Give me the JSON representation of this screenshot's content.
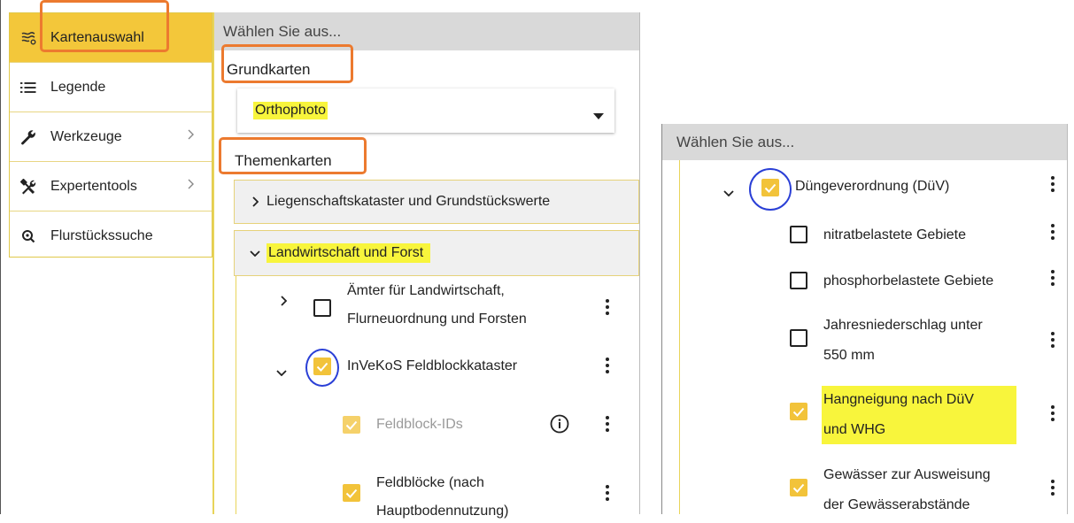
{
  "sidebar": {
    "items": [
      {
        "label": "Kartenauswahl",
        "icon": "layers-icon",
        "active": true
      },
      {
        "label": "Legende",
        "icon": "list-icon",
        "active": false
      },
      {
        "label": "Werkzeuge",
        "icon": "wrench-icon",
        "active": false,
        "has_submenu": true
      },
      {
        "label": "Expertentools",
        "icon": "tools-icon",
        "active": false,
        "has_submenu": true
      },
      {
        "label": "Flurstückssuche",
        "icon": "search-icon",
        "active": false
      }
    ]
  },
  "panel": {
    "header": "Wählen Sie aus...",
    "grundkarten_label": "Grundkarten",
    "basemap_select": {
      "value": "Orthophoto"
    },
    "themenkarten_label": "Themenkarten",
    "groups": [
      {
        "label": "Liegenschaftskataster und Grundstückswerte",
        "expanded": false
      },
      {
        "label": "Landwirtschaft und Forst",
        "expanded": true
      }
    ],
    "layers": [
      {
        "line1": "Ämter für Landwirtschaft,",
        "line2": "Flurneuordnung und Forsten",
        "checked": false,
        "expandable": true,
        "expanded": false
      },
      {
        "line1": "InVeKoS Feldblockkataster",
        "checked": true,
        "expandable": true,
        "expanded": true
      },
      {
        "line1": "Feldblock-IDs",
        "checked": true,
        "disabled": true,
        "info": true
      },
      {
        "line1": "Feldblöcke (nach",
        "line2": "Hauptbodennutzung)",
        "checked": true
      }
    ]
  },
  "right_panel": {
    "header": "Wählen Sie aus...",
    "layers": [
      {
        "line1": "Düngeverordnung (DüV)",
        "checked": true,
        "expandable": true,
        "expanded": true
      },
      {
        "line1": "nitratbelastete Gebiete",
        "checked": false
      },
      {
        "line1": "phosphorbelastete Gebiete",
        "checked": false
      },
      {
        "line1": "Jahresniederschlag unter",
        "line2": "550 mm",
        "checked": false
      },
      {
        "line1": "Hangneigung nach DüV",
        "line2": "und WHG",
        "checked": true,
        "highlighted": true
      },
      {
        "line1": "Gewässer zur Ausweisung",
        "line2": "der Gewässerabstände",
        "checked": true
      }
    ]
  },
  "colors": {
    "accent": "#f3c73a",
    "annotation_orange": "#ec7a2f",
    "annotation_blue": "#2a3fd6",
    "highlight": "#f8f53c"
  }
}
